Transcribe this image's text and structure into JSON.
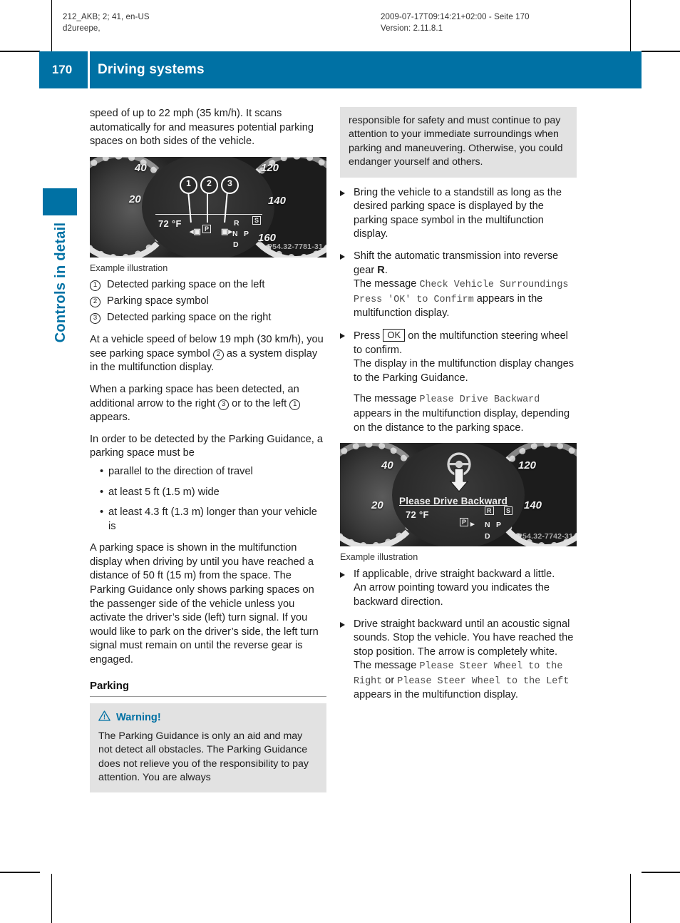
{
  "production_header": {
    "left_line1": "212_AKB; 2; 41, en-US",
    "left_line2": "d2ureepe,",
    "right_line1": "2009-07-17T09:14:21+02:00 - Seite 170",
    "right_line2": "Version: 2.11.8.1"
  },
  "header": {
    "page_number": "170",
    "title": "Driving systems",
    "accent_color": "#0071a4"
  },
  "side_tab": {
    "label": "Controls in detail"
  },
  "left_column": {
    "intro_paragraph": "speed of up to 22 mph (35 km/h). It scans automatically for and measures potential parking spaces on both sides of the vehicle.",
    "figure1": {
      "caption": "Example illustration",
      "watermark": "P54.32-7781-31",
      "temperature": "72 °F",
      "speed_labels": [
        "20",
        "40",
        "120",
        "140",
        "160"
      ],
      "gear_letters": [
        "R",
        "N",
        "D"
      ],
      "gear_indicators": [
        "P",
        "S"
      ],
      "selector_label": "P",
      "callouts": [
        "1",
        "2",
        "3"
      ]
    },
    "legend": [
      {
        "num": "1",
        "text": "Detected parking space on the left"
      },
      {
        "num": "2",
        "text": "Parking space symbol"
      },
      {
        "num": "3",
        "text": "Detected parking space on the right"
      }
    ],
    "para_speed_a": "At a vehicle speed of below 19 mph (30 km/h), you see parking space symbol ",
    "para_speed_b": " as a system display in the multifunction display.",
    "para_detect_a": "When a parking space has been detected, an additional arrow to the right ",
    "para_detect_b": " or to the left ",
    "para_detect_c": " appears.",
    "para_requirements": "In order to be detected by the Parking Guidance, a parking space must be",
    "bullets": [
      "parallel to the direction of travel",
      "at least 5 ft (1.5 m) wide",
      "at least 4.3 ft (1.3 m) longer than your vehicle is"
    ],
    "para_distance": "A parking space is shown in the multifunction display when driving by until you have reached a distance of 50 ft (15 m) from the space. The Parking Guidance only shows parking spaces on the passenger side of the vehicle unless you activate the driver’s side (left) turn signal. If you would like to park on the driver’s side, the left turn signal must remain on until the reverse gear is engaged.",
    "section_heading": "Parking",
    "warning": {
      "label": "Warning!",
      "text": "The Parking Guidance is only an aid and may not detect all obstacles. The Parking Guidance does not relieve you of the responsibility to pay attention. You are always"
    }
  },
  "right_column": {
    "warning_continued": "responsible for safety and must continue to pay attention to your immediate surroundings when parking and maneuvering. Otherwise, you could endanger yourself and others.",
    "step1": "Bring the vehicle to a standstill as long as the desired parking space is displayed by the parking space symbol in the multifunction display.",
    "step2_a": "Shift the automatic transmission into reverse gear ",
    "step2_gear": "R",
    "step2_b": ".",
    "step2_msg_prefix": "The message ",
    "step2_msg": "Check Vehicle Surroundings Press 'OK' to Confirm",
    "step2_msg_suffix": " appears in the multifunction display.",
    "step3_a": "Press ",
    "step3_key": "OK",
    "step3_b": " on the multifunction steering wheel to confirm.",
    "step3_sub": "The display in the multifunction display changes to the Parking Guidance.",
    "step3_msg_prefix": "The message ",
    "step3_msg": "Please Drive Backward",
    "step3_msg_suffix": " appears in the multifunction display, depending on the distance to the parking space.",
    "figure2": {
      "caption": "Example illustration",
      "watermark": "P54.32-7742-31",
      "message": "Please Drive Backward",
      "temperature": "72 °F",
      "speed_labels": [
        "20",
        "40",
        "120",
        "140"
      ],
      "gear_letters": [
        "N",
        "P",
        "D"
      ],
      "gear_indicators": [
        "R",
        "S"
      ],
      "selector_label": "P"
    },
    "step4": "If applicable, drive straight backward a little.",
    "step4_sub": "An arrow pointing toward you indicates the backward direction.",
    "step5": "Drive straight backward until an acoustic signal sounds. Stop the vehicle. You have reached the stop position. The arrow is completely white.",
    "step5_msg_prefix": "The message ",
    "step5_msg1": "Please Steer Wheel to the Right",
    "step5_or": " or ",
    "step5_msg2": "Please Steer Wheel to the Left",
    "step5_msg_suffix": " appears in the multifunction display."
  }
}
